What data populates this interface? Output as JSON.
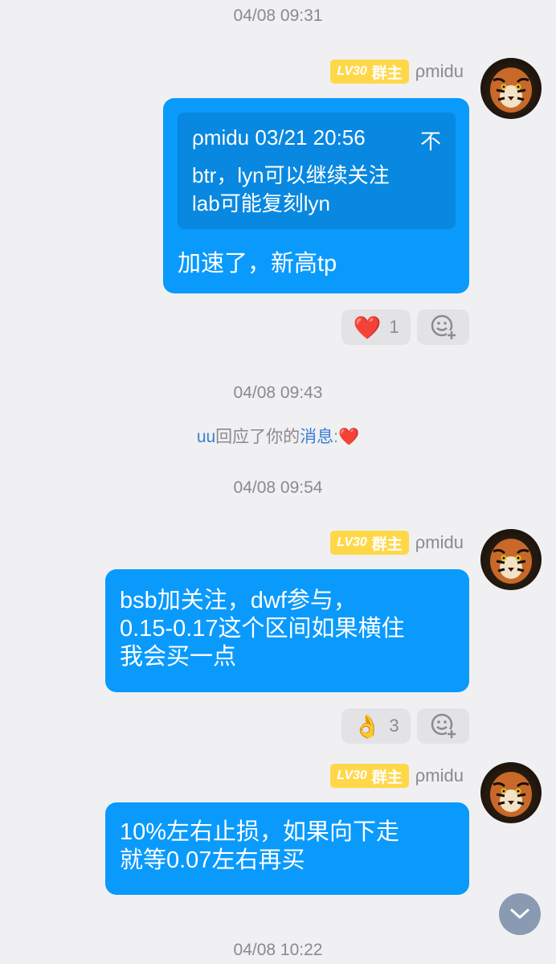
{
  "timestamps": [
    "04/08 09:31",
    "04/08 09:43",
    "04/08 09:54",
    "04/08 10:22"
  ],
  "sender": {
    "name": "ρmidu",
    "level": "LV30",
    "role": "群主"
  },
  "messages": [
    {
      "quote": {
        "author_time": "ρmidu 03/21 20:56",
        "pin_label": "不",
        "lines": [
          "btr，lyn可以继续关注",
          "lab可能复刻lyn"
        ]
      },
      "text": "加速了，新高tp",
      "reaction": {
        "emoji": "❤️",
        "count": "1"
      }
    },
    {
      "lines": [
        "bsb加关注，dwf参与，",
        "0.15-0.17这个区间如果横住",
        "我会买一点"
      ],
      "reaction": {
        "emoji": "👌",
        "count": "3"
      }
    },
    {
      "lines": [
        "10%左右止损，如果向下走",
        "就等0.07左右再买"
      ]
    }
  ],
  "notice": {
    "user": "uu",
    "middle": "回应了你的",
    "link": "消息",
    "colon": ":",
    "emoji": "❤️"
  },
  "colors": {
    "bubble": "#0a9afc",
    "badge": "#ffd84a",
    "background": "#f0f0f2"
  }
}
